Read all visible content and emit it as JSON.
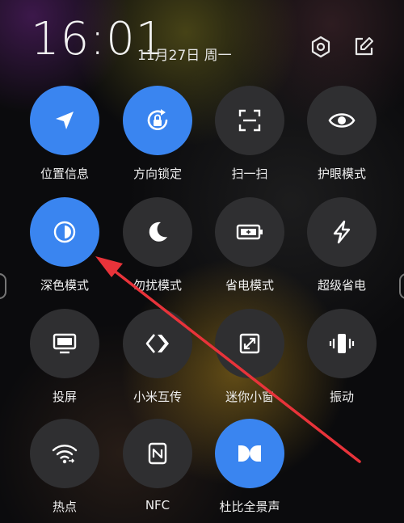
{
  "status": {
    "time": "16:01",
    "date": "11月27日 周一"
  },
  "header_icons": [
    "settings-icon",
    "edit-icon"
  ],
  "tiles": [
    {
      "label": "位置信息",
      "icon": "location-icon",
      "active": true
    },
    {
      "label": "方向锁定",
      "icon": "rotation-lock-icon",
      "active": true
    },
    {
      "label": "扫一扫",
      "icon": "scan-icon",
      "active": false
    },
    {
      "label": "护眼模式",
      "icon": "eye-icon",
      "active": false
    },
    {
      "label": "深色模式",
      "icon": "dark-mode-icon",
      "active": true
    },
    {
      "label": "勿扰模式",
      "icon": "moon-icon",
      "active": false
    },
    {
      "label": "省电模式",
      "icon": "battery-icon",
      "active": false
    },
    {
      "label": "超级省电",
      "icon": "bolt-icon",
      "active": false
    },
    {
      "label": "投屏",
      "icon": "cast-screen-icon",
      "active": false
    },
    {
      "label": "小米互传",
      "icon": "share-icon",
      "active": false
    },
    {
      "label": "迷你小窗",
      "icon": "mini-window-icon",
      "active": false
    },
    {
      "label": "振动",
      "icon": "vibrate-icon",
      "active": false
    },
    {
      "label": "热点",
      "icon": "hotspot-icon",
      "active": false
    },
    {
      "label": "NFC",
      "icon": "nfc-icon",
      "active": false
    },
    {
      "label": "杜比全景声",
      "icon": "dolby-icon",
      "active": true
    }
  ],
  "colors": {
    "active": "#3a85f0",
    "inactive": "#2f2f31",
    "annotation_arrow": "#e8333a"
  }
}
